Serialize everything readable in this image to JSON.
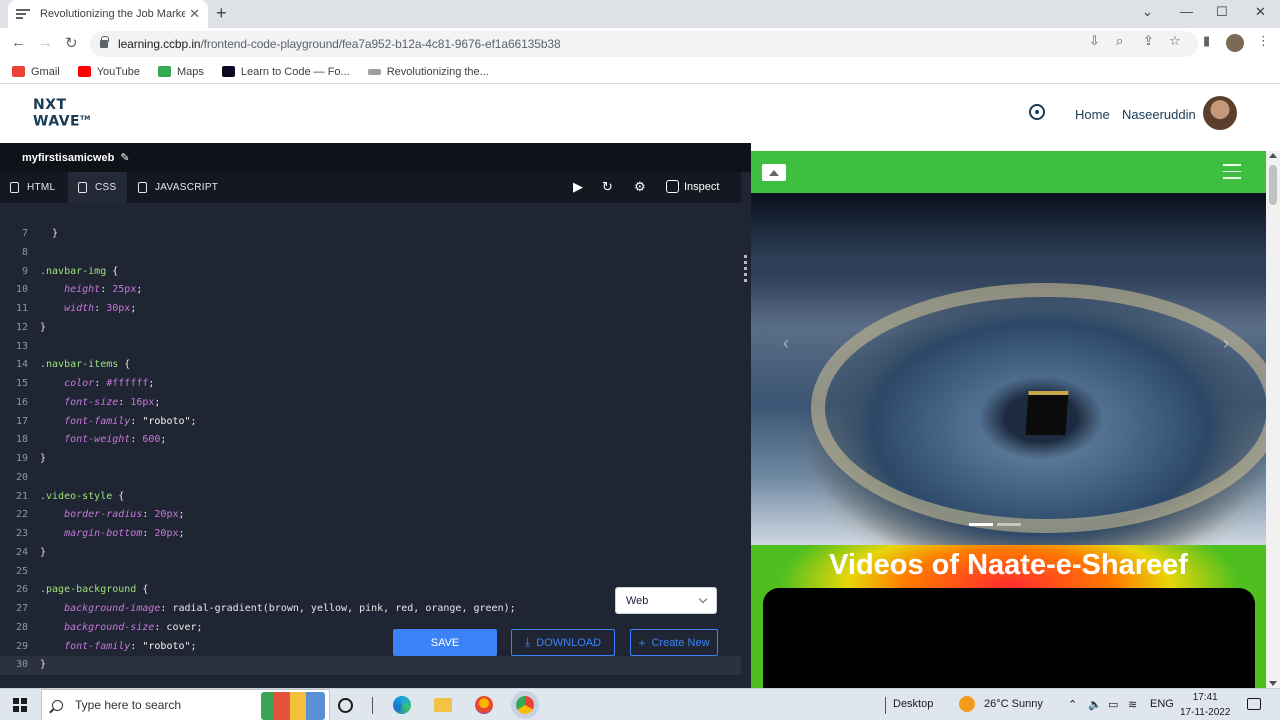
{
  "browser": {
    "tab_title": "Revolutionizing the Job Market |",
    "tab_close": "✕",
    "new_tab": "+",
    "url_host": "learning.ccbp.in",
    "url_path": "/frontend-code-playground/fea7a952-b12a-4c81-9676-ef1a66135b38",
    "bookmarks": [
      {
        "label": "Gmail",
        "color": "#ea4335"
      },
      {
        "label": "YouTube",
        "color": "#ff0000"
      },
      {
        "label": "Maps",
        "color": "#34a853"
      },
      {
        "label": "Learn to Code — Fo...",
        "color": "#0a0a23"
      },
      {
        "label": "Revolutionizing the...",
        "color": "#5f6368"
      }
    ]
  },
  "site": {
    "logo_top": "NXT",
    "logo_bottom": "WAVE",
    "logo_tm": "TM",
    "nav_home": "Home",
    "user_name": "Naseeruddin"
  },
  "editor": {
    "project_name": "myfirstisamicweb",
    "tabs": [
      {
        "label": "HTML",
        "active": false
      },
      {
        "label": "CSS",
        "active": true
      },
      {
        "label": "JAVASCRIPT",
        "active": false
      }
    ],
    "inspect_label": "Inspect",
    "view_select": "Web",
    "save_label": "SAVE",
    "download_label": "DOWNLOAD",
    "create_label": "Create New",
    "lines": [
      {
        "n": "7",
        "t": [
          [
            "}",
            "ct"
          ]
        ]
      },
      {
        "n": "8",
        "t": []
      },
      {
        "n": "9",
        "t": [
          [
            ".navbar-img",
            "sel"
          ],
          [
            " {",
            ""
          ]
        ]
      },
      {
        "n": "10",
        "t": [
          [
            "    height",
            "prop"
          ],
          [
            ": ",
            ""
          ],
          [
            "25px",
            "num"
          ],
          [
            ";",
            ""
          ]
        ]
      },
      {
        "n": "11",
        "t": [
          [
            "    width",
            "prop"
          ],
          [
            ": ",
            ""
          ],
          [
            "30px",
            "num"
          ],
          [
            ";",
            ""
          ]
        ]
      },
      {
        "n": "12",
        "t": [
          [
            "}",
            ""
          ]
        ]
      },
      {
        "n": "13",
        "t": []
      },
      {
        "n": "14",
        "t": [
          [
            ".navbar-items",
            "sel"
          ],
          [
            " {",
            ""
          ]
        ]
      },
      {
        "n": "15",
        "t": [
          [
            "    color",
            "prop"
          ],
          [
            ": ",
            ""
          ],
          [
            "#ffffff",
            "num"
          ],
          [
            ";",
            ""
          ]
        ]
      },
      {
        "n": "16",
        "t": [
          [
            "    font-size",
            "prop"
          ],
          [
            ": ",
            ""
          ],
          [
            "16px",
            "num"
          ],
          [
            ";",
            ""
          ]
        ]
      },
      {
        "n": "17",
        "t": [
          [
            "    font-family",
            "prop"
          ],
          [
            ": ",
            ""
          ],
          [
            "\"roboto\"",
            "str"
          ],
          [
            ";",
            ""
          ]
        ]
      },
      {
        "n": "18",
        "t": [
          [
            "    font-weight",
            "prop"
          ],
          [
            ": ",
            ""
          ],
          [
            "600",
            "num"
          ],
          [
            ";",
            ""
          ]
        ]
      },
      {
        "n": "19",
        "t": [
          [
            "}",
            ""
          ]
        ]
      },
      {
        "n": "20",
        "t": []
      },
      {
        "n": "21",
        "t": [
          [
            ".video-style",
            "sel"
          ],
          [
            " {",
            ""
          ]
        ]
      },
      {
        "n": "22",
        "t": [
          [
            "    border-radius",
            "prop"
          ],
          [
            ": ",
            ""
          ],
          [
            "20px",
            "num"
          ],
          [
            ";",
            ""
          ]
        ]
      },
      {
        "n": "23",
        "t": [
          [
            "    margin-bottom",
            "prop"
          ],
          [
            ": ",
            ""
          ],
          [
            "20px",
            "num"
          ],
          [
            ";",
            ""
          ]
        ]
      },
      {
        "n": "24",
        "t": [
          [
            "}",
            ""
          ]
        ]
      },
      {
        "n": "25",
        "t": []
      },
      {
        "n": "26",
        "t": [
          [
            ".page-background",
            "sel"
          ],
          [
            " {",
            ""
          ]
        ]
      },
      {
        "n": "27",
        "t": [
          [
            "    background-image",
            "prop"
          ],
          [
            ": radial-gradient(brown, yellow, pink, red, orange, green);",
            ""
          ]
        ]
      },
      {
        "n": "28",
        "t": [
          [
            "    background-size",
            "prop"
          ],
          [
            ": cover;",
            ""
          ]
        ]
      },
      {
        "n": "29",
        "t": [
          [
            "    font-family",
            "prop"
          ],
          [
            ": ",
            ""
          ],
          [
            "\"roboto\"",
            "str"
          ],
          [
            ";",
            ""
          ]
        ]
      },
      {
        "n": "30",
        "t": [
          [
            "}",
            ""
          ]
        ]
      }
    ]
  },
  "preview": {
    "video_title": "Videos of Naate-e-Shareef"
  },
  "taskbar": {
    "search_placeholder": "Type here to search",
    "desktop_label": "Desktop",
    "weather": "26°C  Sunny",
    "lang": "ENG",
    "time": "17:41",
    "date": "17-11-2022"
  }
}
